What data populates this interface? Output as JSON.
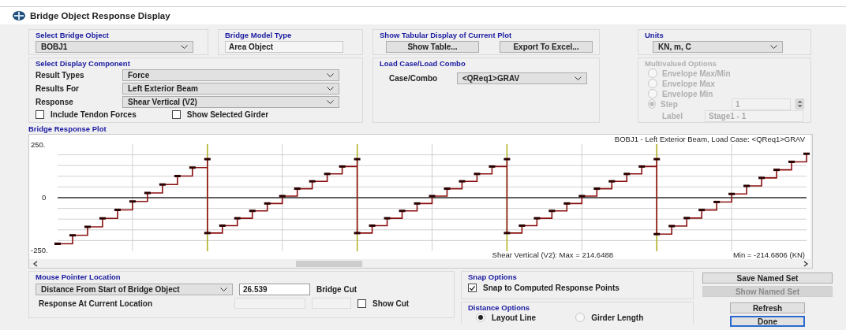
{
  "window": {
    "title": "Bridge Object Response Display"
  },
  "bridge_object": {
    "label": "Select Bridge Object",
    "value": "BOBJ1"
  },
  "model_type": {
    "label": "Bridge Model Type",
    "value": "Area Object"
  },
  "tabular": {
    "label": "Show Tabular Display of Current Plot",
    "buttons": [
      "Show Table...",
      "Export To Excel..."
    ]
  },
  "units": {
    "label": "Units",
    "value": "KN, m, C"
  },
  "display_component": {
    "label": "Select Display Component",
    "fields": [
      {
        "label": "Result Types",
        "value": "Force"
      },
      {
        "label": "Results For",
        "value": "Left Exterior Beam"
      },
      {
        "label": "Response",
        "value": "Shear Vertical  (V2)"
      }
    ],
    "checkboxes": [
      {
        "label": "Include Tendon Forces",
        "checked": false
      },
      {
        "label": "Show Selected Girder",
        "checked": false
      }
    ]
  },
  "load_case": {
    "label": "Load Case/Load Combo",
    "field_label": "Case/Combo",
    "value": "<QReq1>GRAV"
  },
  "multivalued": {
    "label": "Multivalued Options",
    "disabled": true,
    "options": [
      {
        "label": "Envelope Max/Min",
        "selected": false
      },
      {
        "label": "Envelope Max",
        "selected": false
      },
      {
        "label": "Envelope Min",
        "selected": false
      },
      {
        "label": "Step",
        "selected": true
      }
    ],
    "step_value": "1",
    "label_caption": "Label",
    "label_value": "Stage1 - 1"
  },
  "plot": {
    "label": "Bridge Response Plot",
    "title": "BOBJ1 - Left Exterior Beam,  Load Case: <QReq1>GRAV",
    "footer_left": "Shear Vertical  (V2):  Max = 214.6488",
    "footer_right": "Min = -214.6806  (KN)",
    "y_labels": [
      "250.",
      "0",
      "-250."
    ]
  },
  "mouse_pointer": {
    "label": "Mouse Pointer Location",
    "mode": "Distance From Start of Bridge Object",
    "value": "26.539",
    "value_caption": "Bridge Cut",
    "response_label": "Response At Current Location",
    "show_cut": {
      "label": "Show Cut",
      "checked": false
    }
  },
  "snap": {
    "label": "Snap Options",
    "option": {
      "label": "Snap to Computed Response Points",
      "checked": true
    }
  },
  "distance": {
    "label": "Distance Options",
    "options": [
      {
        "label": "Layout Line",
        "selected": true
      },
      {
        "label": "Girder Length",
        "selected": false
      }
    ]
  },
  "actions": [
    {
      "label": "Save Named Set",
      "disabled": false,
      "focused": false
    },
    {
      "label": "Show Named Set",
      "disabled": true,
      "focused": false
    },
    {
      "label": "Refresh",
      "disabled": false,
      "focused": false
    },
    {
      "label": "Done",
      "disabled": false,
      "focused": true
    }
  ]
}
